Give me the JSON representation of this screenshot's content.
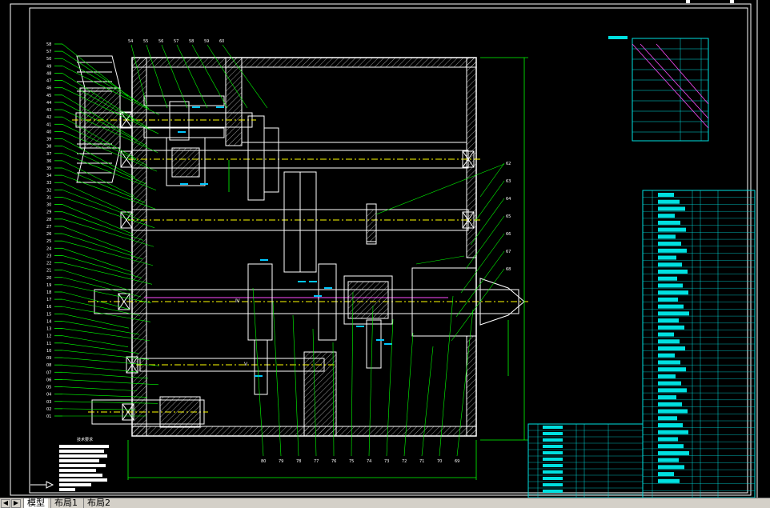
{
  "canvas": {
    "background": "#000000",
    "line_colors": {
      "outline": "#ffffff",
      "housing": "#ffffff",
      "leader": "#00ff00",
      "table": "#00e0e0",
      "center": "#ffff00",
      "hatch": "#00c8ff",
      "frame": "#ffffff",
      "hidden": "#ff4dff",
      "dim": "#00ff00"
    }
  },
  "labels": {
    "left_part_numbers": [
      "58",
      "57",
      "50",
      "49",
      "48",
      "47",
      "46",
      "45",
      "44",
      "43",
      "42",
      "41",
      "40",
      "39",
      "38",
      "37",
      "36",
      "35",
      "34",
      "33",
      "32",
      "31",
      "30",
      "29",
      "28",
      "27",
      "26",
      "25",
      "24",
      "23",
      "22",
      "21",
      "20",
      "19",
      "18",
      "17",
      "16",
      "15",
      "14",
      "13",
      "12",
      "11",
      "10",
      "09",
      "08",
      "07",
      "06",
      "05",
      "04",
      "03",
      "02",
      "01"
    ],
    "top_part_numbers": [
      "54",
      "55",
      "56",
      "57",
      "58",
      "59",
      "60"
    ],
    "right_part_numbers": [
      "62",
      "63",
      "64",
      "65",
      "66",
      "67",
      "68"
    ],
    "bottom_part_numbers": [
      "80",
      "79",
      "78",
      "77",
      "76",
      "75",
      "74",
      "73",
      "72",
      "71",
      "70",
      "69"
    ],
    "shaft_roman": [
      "Ⅳ",
      "Ⅴ"
    ],
    "technical_requirements_title": "技术要求"
  },
  "tabs": {
    "model": "模型",
    "layout1": "布局1",
    "layout2": "布局2"
  }
}
